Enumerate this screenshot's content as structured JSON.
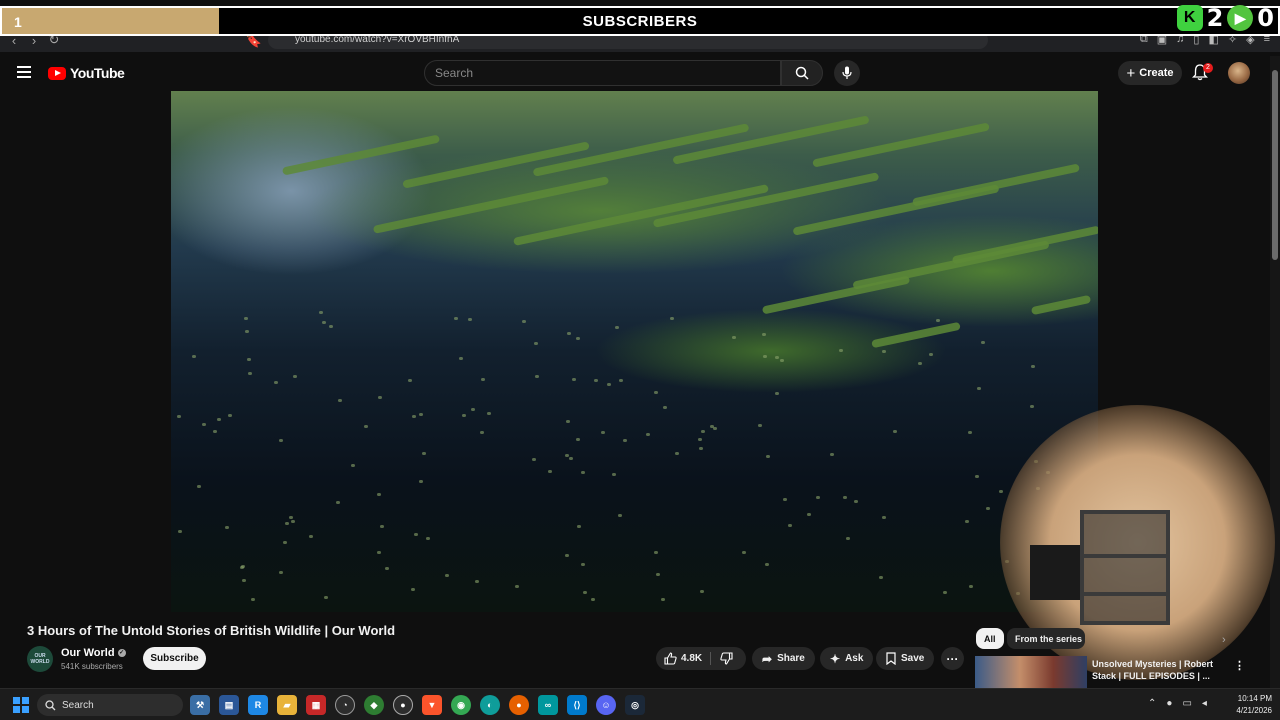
{
  "overlay": {
    "count": "1",
    "title": "SUBSCRIBERS",
    "goal_progress": 0.17,
    "badge_k_label": "K",
    "badge_k_count": "2",
    "badge_play_count": "0"
  },
  "browser": {
    "url": "youtube.com/watch?v=XrOVBHInfhA"
  },
  "header": {
    "logo_text": "YouTube",
    "search_placeholder": "Search",
    "create_label": "Create",
    "notification_count": "2"
  },
  "video": {
    "title": "3 Hours of The Untold Stories of British Wildlife | Our World"
  },
  "channel": {
    "avatar_text": "OUR WORLD",
    "name": "Our World",
    "subscribers": "541K subscribers",
    "subscribe_label": "Subscribe"
  },
  "actions": {
    "likes": "4.8K",
    "share_label": "Share",
    "ask_label": "Ask",
    "save_label": "Save",
    "more_label": "···"
  },
  "sidebar": {
    "chips": [
      "All",
      "From the series"
    ],
    "recommendation_title": "Unsolved Mysteries | Robert Stack | FULL EPISODES | ..."
  },
  "taskbar": {
    "search_label": "Search",
    "time": "10:14 PM",
    "date": "4/21/2026"
  }
}
